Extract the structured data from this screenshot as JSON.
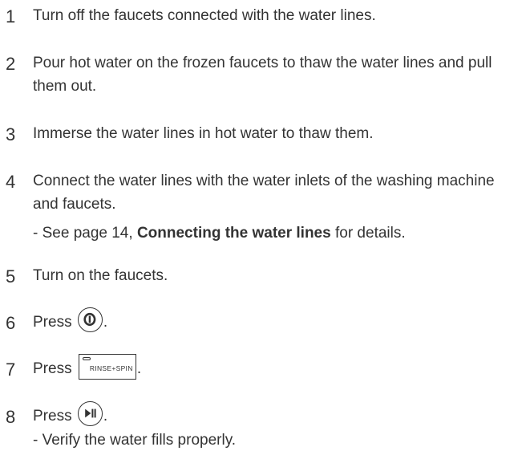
{
  "steps": [
    {
      "number": "1",
      "text": "Turn off the faucets connected with the water lines."
    },
    {
      "number": "2",
      "text": "Pour hot water on the frozen faucets to thaw the water lines and pull them out."
    },
    {
      "number": "3",
      "text": "Immerse the water lines in hot water to thaw them."
    },
    {
      "number": "4",
      "text": "Connect the water lines with the water inlets of the washing machine and faucets.",
      "note_prefix": "- See page 14, ",
      "note_bold": "Connecting the water lines",
      "note_suffix": " for details."
    },
    {
      "number": "5",
      "text": "Turn on the faucets."
    },
    {
      "number": "6",
      "text": "Press ",
      "icon": "power-button-icon",
      "after": "."
    },
    {
      "number": "7",
      "text": "Press ",
      "button_label": "RINSE+SPIN",
      "after": "."
    },
    {
      "number": "8",
      "text": "Press ",
      "icon": "start-pause-button-icon",
      "after": ".",
      "note": "- Verify the water fills properly."
    }
  ]
}
